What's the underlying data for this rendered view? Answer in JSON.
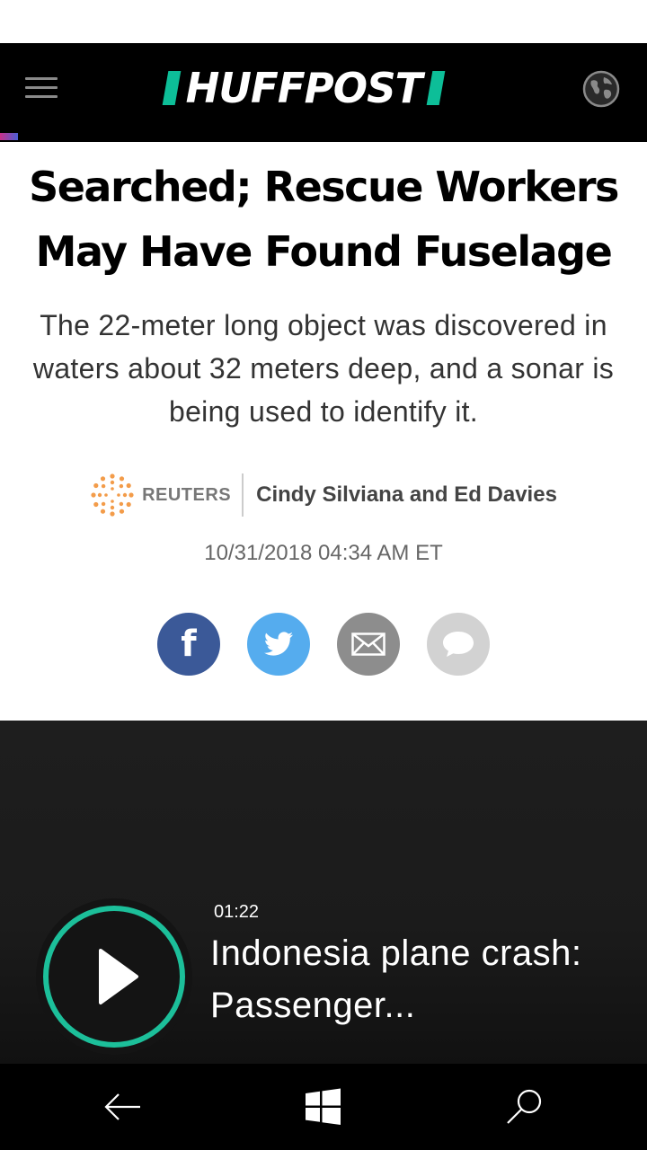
{
  "header": {
    "logo_text": "HUFFPOST",
    "menu_icon": "hamburger-menu-icon",
    "edition_icon": "globe-icon",
    "accent_color": "#0dbe98"
  },
  "article": {
    "headline": "Searched; Rescue Workers May Have Found Fuselage",
    "dek": "The 22-meter long object was discovered in waters about 32 meters deep, and a sonar is being used to identify it.",
    "source": "REUTERS",
    "authors": "Cindy Silviana and Ed Davies",
    "timestamp": "10/31/2018 04:34 AM ET"
  },
  "share": {
    "buttons": [
      {
        "icon": "facebook-icon",
        "color": "#3b5998"
      },
      {
        "icon": "twitter-icon",
        "color": "#55acee"
      },
      {
        "icon": "email-icon",
        "color": "#8d8d8d"
      },
      {
        "icon": "comment-icon",
        "color": "#d2d2d2"
      }
    ]
  },
  "video": {
    "duration": "01:22",
    "title": "Indonesia plane crash: Passenger...",
    "play_icon": "play-icon",
    "ring_color": "#1cbf9a"
  },
  "navbar": {
    "back_icon": "back-arrow-icon",
    "home_icon": "windows-logo-icon",
    "search_icon": "search-icon"
  }
}
